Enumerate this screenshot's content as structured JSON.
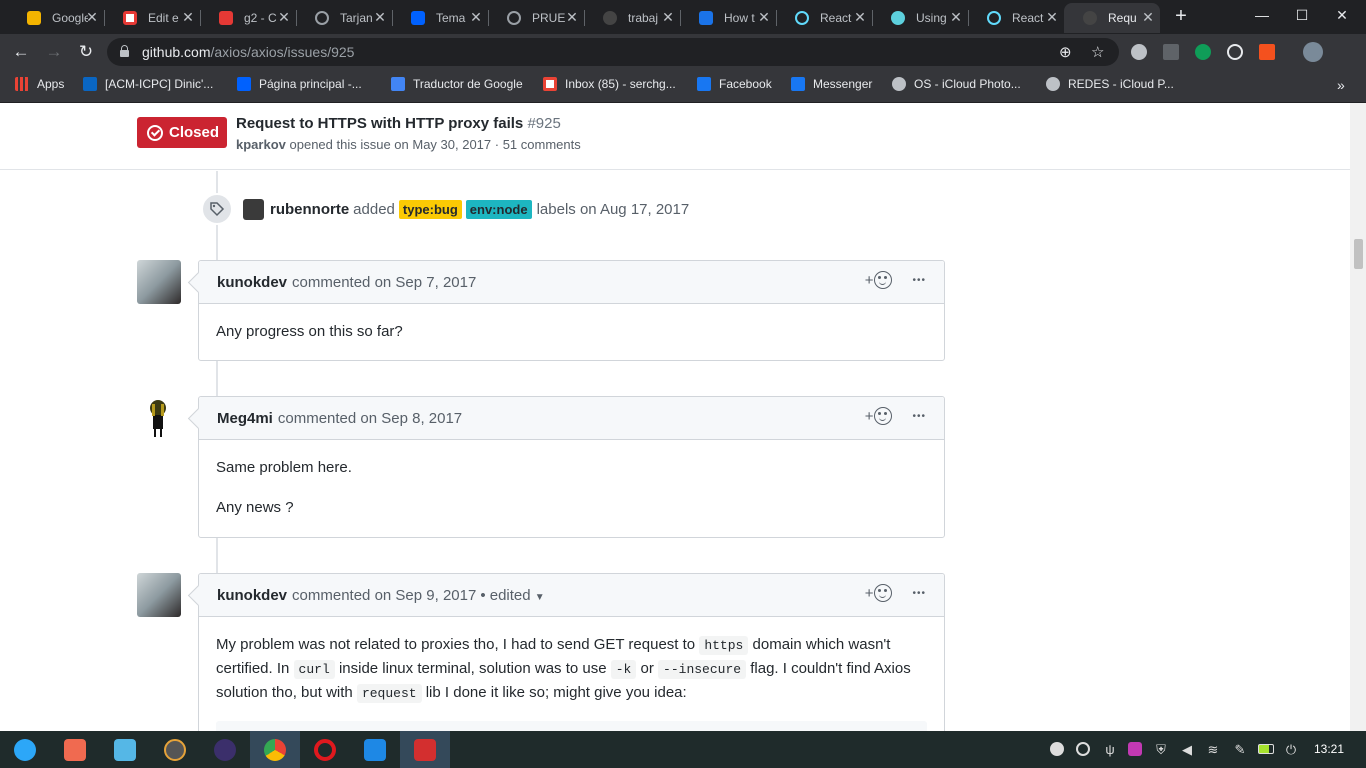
{
  "browser": {
    "tabs": [
      {
        "title": "Google",
        "color": "#f4b400"
      },
      {
        "title": "Edit e",
        "color": "#ffffff"
      },
      {
        "title": "g2 - C",
        "color": "#e53935"
      },
      {
        "title": "Tarjan",
        "color": "#9aa0a6"
      },
      {
        "title": "Tema",
        "color": "#0061fe"
      },
      {
        "title": "PRUE",
        "color": "#9aa0a6"
      },
      {
        "title": "trabaj",
        "color": "#555555"
      },
      {
        "title": "How t",
        "color": "#1a73e8"
      },
      {
        "title": "React",
        "color": "#61dafb"
      },
      {
        "title": "Using",
        "color": "#5dd0dd"
      },
      {
        "title": "React",
        "color": "#61dafb"
      },
      {
        "title": "Requ",
        "color": "#555555"
      }
    ],
    "url_host": "github.com",
    "url_path": "/axios/axios/issues/925",
    "bookmarks": [
      {
        "label": "Apps",
        "icon": "apps-grid-icon",
        "color": "#e8eaed"
      },
      {
        "label": "[ACM-ICPC] Dinic'...",
        "icon": "linkedin-icon",
        "color": "#0a66c2"
      },
      {
        "label": "Página principal -...",
        "icon": "dropbox-icon",
        "color": "#0061fe"
      },
      {
        "label": "Traductor de Google",
        "icon": "translate-icon",
        "color": "#4285f4"
      },
      {
        "label": "Inbox (85) - serchg...",
        "icon": "gmail-icon",
        "color": "#ea4335"
      },
      {
        "label": "Facebook",
        "icon": "facebook-icon",
        "color": "#1877f2"
      },
      {
        "label": "Messenger",
        "icon": "facebook-icon",
        "color": "#1877f2"
      },
      {
        "label": "OS - iCloud Photo...",
        "icon": "apple-icon",
        "color": "#e8eaed"
      },
      {
        "label": "REDES - iCloud P...",
        "icon": "apple-icon",
        "color": "#e8eaed"
      }
    ],
    "more_bookmarks": "»"
  },
  "issue": {
    "state": "Closed",
    "title": "Request to HTTPS with HTTP proxy fails",
    "number": "#925",
    "author": "kparkov",
    "meta": "opened this issue on May 30, 2017 · 51 comments"
  },
  "label_event": {
    "actor": "rubennorte",
    "action": "added",
    "labels": [
      {
        "name": "type:bug",
        "color": "#fbca04"
      },
      {
        "name": "env:node",
        "color": "#1db6c1"
      }
    ],
    "suffix": "labels on Aug 17, 2017"
  },
  "comments": [
    {
      "author": "kunokdev",
      "date": "commented on Sep 7, 2017",
      "body": [
        "Any progress on this so far?"
      ]
    },
    {
      "author": "Meg4mi",
      "date": "commented on Sep 8, 2017",
      "body": [
        "Same problem here.",
        "Any news ?"
      ]
    },
    {
      "author": "kunokdev",
      "date": "commented on Sep 9, 2017",
      "edited": "• edited",
      "body_parts": {
        "t1": "My problem was not related to proxies tho, I had to send GET request to",
        "c1": "https",
        "t2": "domain which wasn't certified. In",
        "c2": "curl",
        "t3": "inside linux terminal, solution was to use",
        "c3": "-k",
        "t4": "or",
        "c4": "--insecure",
        "t5": "flag. I couldn't find Axios solution tho, but with",
        "c5": "request",
        "t6": "lib I done it like so; might give you idea:"
      }
    }
  ],
  "reaction_plus": "+",
  "more_dots": "•••",
  "taskbar": {
    "clock": "13:21"
  }
}
